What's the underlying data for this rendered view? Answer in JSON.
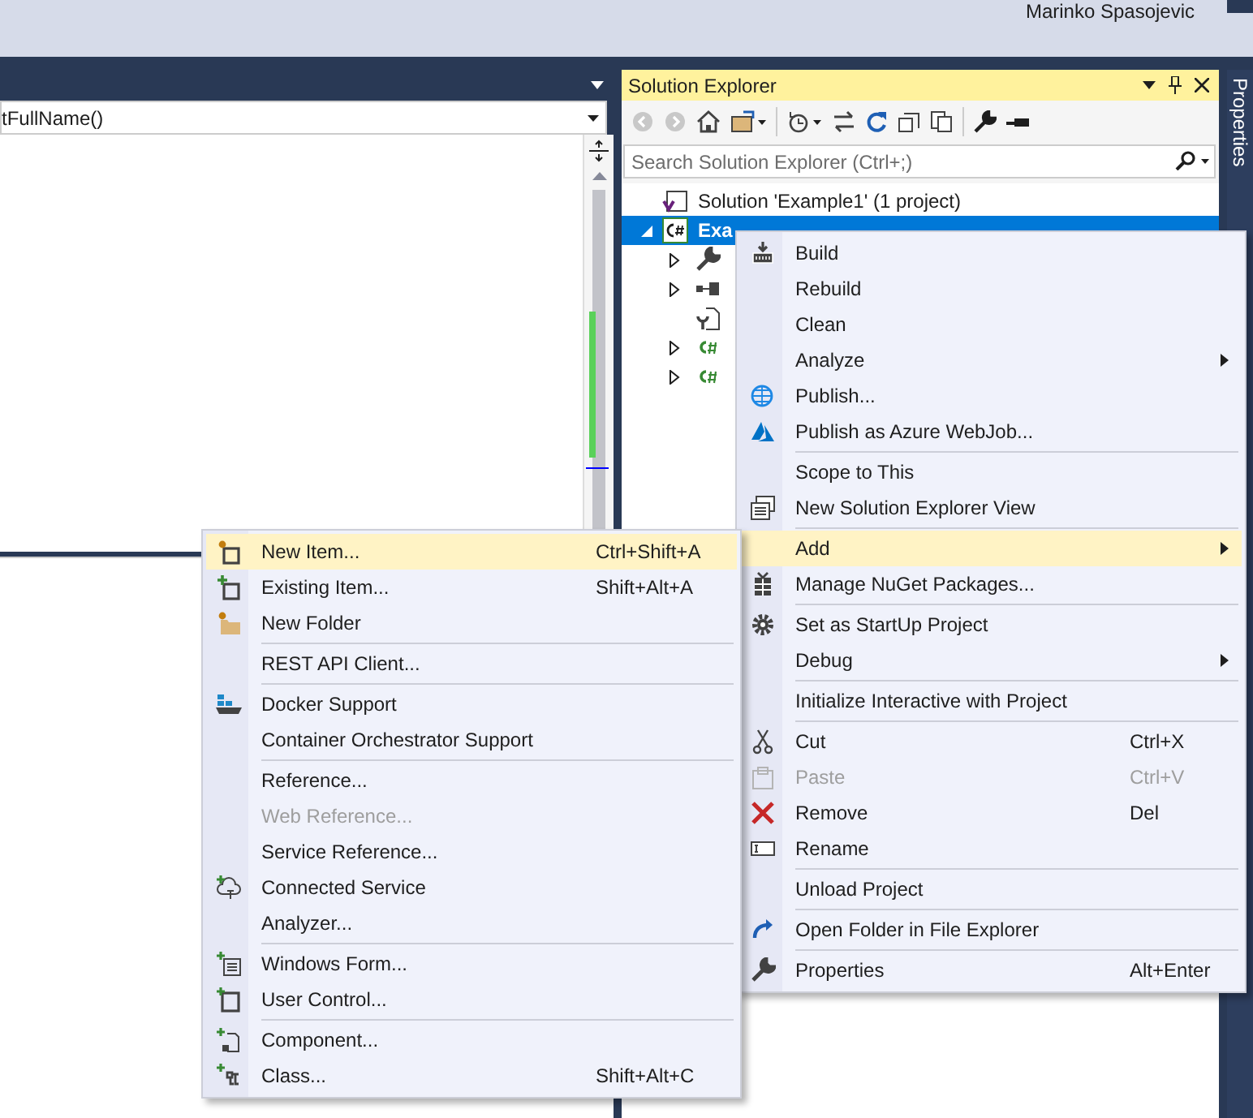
{
  "account": {
    "user": "Marinko Spasojevic"
  },
  "editor": {
    "member_dropdown": "tFullName()"
  },
  "solution_explorer": {
    "title": "Solution Explorer",
    "search": {
      "placeholder": "Search Solution Explorer (Ctrl+;)"
    },
    "tree": [
      {
        "label": "Solution 'Example1' (1 project)",
        "selected": false
      },
      {
        "label": "Exa",
        "selected": true,
        "expanded": true,
        "children": [
          {
            "expandable": true,
            "expanded": false
          },
          {
            "expandable": true,
            "expanded": false
          },
          {
            "expandable": false
          },
          {
            "expandable": true,
            "expanded": false
          },
          {
            "expandable": true,
            "expanded": false
          }
        ]
      }
    ]
  },
  "side_tab": "Properties",
  "context_menu": {
    "items": [
      {
        "label": "Build"
      },
      {
        "label": "Rebuild"
      },
      {
        "label": "Clean"
      },
      {
        "label": "Analyze",
        "submenu": true
      },
      {
        "label": "Publish..."
      },
      {
        "label": "Publish as Azure WebJob..."
      },
      {
        "label": "Scope to This",
        "separator_before": true
      },
      {
        "label": "New Solution Explorer View"
      },
      {
        "label": "Add",
        "submenu": true,
        "selected": true,
        "separator_before": true
      },
      {
        "label": "Manage NuGet Packages..."
      },
      {
        "label": "Set as StartUp Project",
        "separator_before": true
      },
      {
        "label": "Debug",
        "submenu": true
      },
      {
        "label": "Initialize Interactive with Project",
        "separator_before": true
      },
      {
        "label": "Cut",
        "shortcut": "Ctrl+X",
        "separator_before": true
      },
      {
        "label": "Paste",
        "shortcut": "Ctrl+V",
        "disabled": true
      },
      {
        "label": "Remove",
        "shortcut": "Del"
      },
      {
        "label": "Rename"
      },
      {
        "label": "Unload Project",
        "separator_before": true
      },
      {
        "label": "Open Folder in File Explorer",
        "separator_before": true
      },
      {
        "label": "Properties",
        "shortcut": "Alt+Enter",
        "separator_before": true
      }
    ]
  },
  "add_submenu": {
    "items": [
      {
        "label": "New Item...",
        "shortcut": "Ctrl+Shift+A",
        "selected": true
      },
      {
        "label": "Existing Item...",
        "shortcut": "Shift+Alt+A"
      },
      {
        "label": "New Folder"
      },
      {
        "label": "REST API Client...",
        "separator_before": true
      },
      {
        "label": "Docker Support",
        "separator_before": true
      },
      {
        "label": "Container Orchestrator Support"
      },
      {
        "label": "Reference...",
        "separator_before": true
      },
      {
        "label": "Web Reference...",
        "disabled": true
      },
      {
        "label": "Service Reference..."
      },
      {
        "label": "Connected Service"
      },
      {
        "label": "Analyzer..."
      },
      {
        "label": "Windows Form...",
        "separator_before": true
      },
      {
        "label": "User Control..."
      },
      {
        "label": "Component...",
        "separator_before": true
      },
      {
        "label": "Class...",
        "shortcut": "Shift+Alt+C"
      }
    ]
  }
}
